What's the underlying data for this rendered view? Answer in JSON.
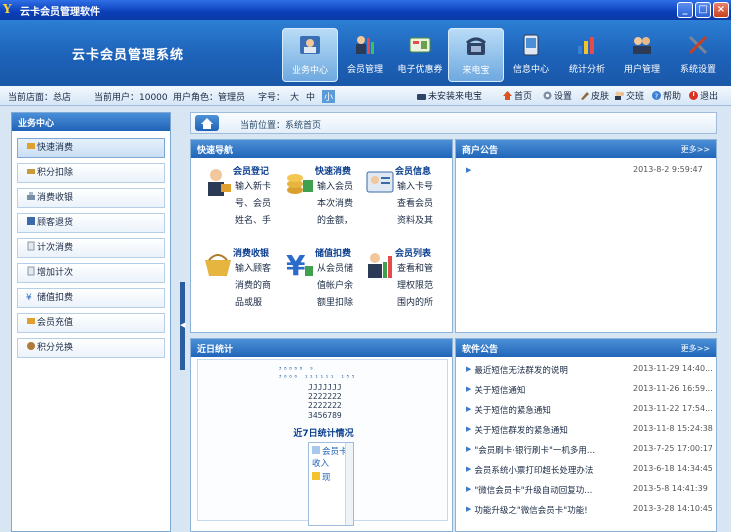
{
  "window": {
    "title": "云卡会员管理软件",
    "controls": {
      "minimize": "_",
      "maximize": "□",
      "close": "×"
    }
  },
  "header": {
    "brand": "云卡会员管理系统",
    "nav": [
      {
        "label": "业务中心",
        "icon": "business-icon",
        "active": true
      },
      {
        "label": "会员管理",
        "icon": "members-icon",
        "active": false
      },
      {
        "label": "电子优惠券",
        "icon": "coupon-icon",
        "active": false
      },
      {
        "label": "来电宝",
        "icon": "phone-icon",
        "active": true
      },
      {
        "label": "信息中心",
        "icon": "message-icon",
        "active": false
      },
      {
        "label": "统计分析",
        "icon": "stats-icon",
        "active": false
      },
      {
        "label": "用户管理",
        "icon": "users-icon",
        "active": false
      },
      {
        "label": "系统设置",
        "icon": "settings-icon",
        "active": false
      }
    ]
  },
  "infobar": {
    "store": "当前店面：总店",
    "user": "当前用户：10000",
    "role": "用户角色：管理员",
    "font_label": "字号：",
    "font_large": "大",
    "font_medium": "中",
    "font_small": "小",
    "caller_status": "未安装来电宝",
    "toolbar": [
      {
        "label": "首页",
        "icon": "home-icon"
      },
      {
        "label": "设置",
        "icon": "settings-icon"
      },
      {
        "label": "皮肤",
        "icon": "skin-icon"
      },
      {
        "label": "交班",
        "icon": "handover-icon"
      },
      {
        "label": "帮助",
        "icon": "help-icon"
      },
      {
        "label": "退出",
        "icon": "exit-icon"
      }
    ]
  },
  "sidebar": {
    "title": "业务中心",
    "items": [
      {
        "label": "快速消费",
        "active": true
      },
      {
        "label": "积分扣除",
        "active": false
      },
      {
        "label": "消费收银",
        "active": false
      },
      {
        "label": "顾客退货",
        "active": false
      },
      {
        "label": "计次消费",
        "active": false
      },
      {
        "label": "增加计次",
        "active": false
      },
      {
        "label": "储值扣费",
        "active": false
      },
      {
        "label": "会员充值",
        "active": false
      },
      {
        "label": "积分兑换",
        "active": false
      }
    ]
  },
  "breadcrumb": {
    "text": "当前位置：系统首页"
  },
  "quick_nav": {
    "title": "快速导航",
    "items": [
      {
        "title": "会员登记",
        "desc": "输入新卡号、会员姓名、手",
        "icon": "register-icon"
      },
      {
        "title": "快速消费",
        "desc": "输入会员本次消费的金额，",
        "icon": "quick-consume-icon"
      },
      {
        "title": "会员信息",
        "desc": "输入卡号查看会员资料及其",
        "icon": "member-info-icon"
      },
      {
        "title": "消费收银",
        "desc": "输入顾客消费的商品或服",
        "icon": "cashier-icon"
      },
      {
        "title": "储值扣费",
        "desc": "从会员储值帐户余额里扣除",
        "icon": "stored-value-icon"
      },
      {
        "title": "会员列表",
        "desc": "查看和管理权限范围内的所",
        "icon": "member-list-icon"
      }
    ]
  },
  "merchant_notice": {
    "title": "商户公告",
    "more": "更多>>",
    "items": [
      {
        "text": "",
        "date": "2013-8-2 9:59:47"
      }
    ]
  },
  "recent_stats": {
    "title": "近日统计",
    "chart_title": "近7日统计情况",
    "axis_text": "³⁸⁸⁸⁸ ⁹\n³⁰⁰⁰ ¹¹¹¹¹¹ ¹⁵⁵",
    "legend": [
      {
        "label": "会员卡收入",
        "color": "#a8c8ec"
      },
      {
        "label": "现",
        "color": "#f2c230"
      }
    ]
  },
  "software_notice": {
    "title": "软件公告",
    "more": "更多>>",
    "items": [
      {
        "text": "最近短信无法群发的说明",
        "date": "2013-11-29 14:40..."
      },
      {
        "text": "关于短信通知",
        "date": "2013-11-26 16:59..."
      },
      {
        "text": "关于短信的紧急通知",
        "date": "2013-11-22 17:54..."
      },
      {
        "text": "关于短信群发的紧急通知",
        "date": "2013-11-8 15:24:38"
      },
      {
        "text": "\"会员刷卡·银行刷卡\"一机多用...",
        "date": "2013-7-25 17:00:17"
      },
      {
        "text": "会员系统小票打印超长处理办法",
        "date": "2013-6-18 14:34:45"
      },
      {
        "text": "\"微信会员卡\"升级自动回复功...",
        "date": "2013-5-8 14:41:39"
      },
      {
        "text": "功能升级之\"微信会员卡\"功能!",
        "date": "2013-3-28 14:10:45"
      }
    ]
  }
}
